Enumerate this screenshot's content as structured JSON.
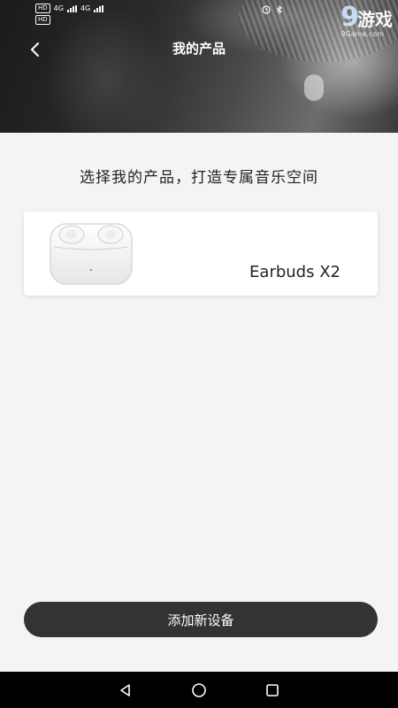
{
  "status_bar": {
    "sim1": "HD",
    "sim1_net": "4G",
    "sim2": "HD",
    "sim2_net": "4G"
  },
  "watermark": {
    "number": "9",
    "text": "游戏",
    "url": "9Game.com"
  },
  "header": {
    "title": "我的产品",
    "back_icon": "chevron-left-icon"
  },
  "main": {
    "subtitle": "选择我的产品，打造专属音乐空间",
    "products": [
      {
        "name": "Earbuds X2",
        "image": "earbuds-case"
      }
    ]
  },
  "footer": {
    "add_device_label": "添加新设备"
  },
  "nav_bar": {
    "back_icon": "triangle-back-icon",
    "home_icon": "circle-home-icon",
    "recents_icon": "square-recents-icon"
  },
  "colors": {
    "button_bg": "#333333",
    "page_bg": "#f4f4f4",
    "card_bg": "#ffffff",
    "nav_bg": "#000000"
  }
}
